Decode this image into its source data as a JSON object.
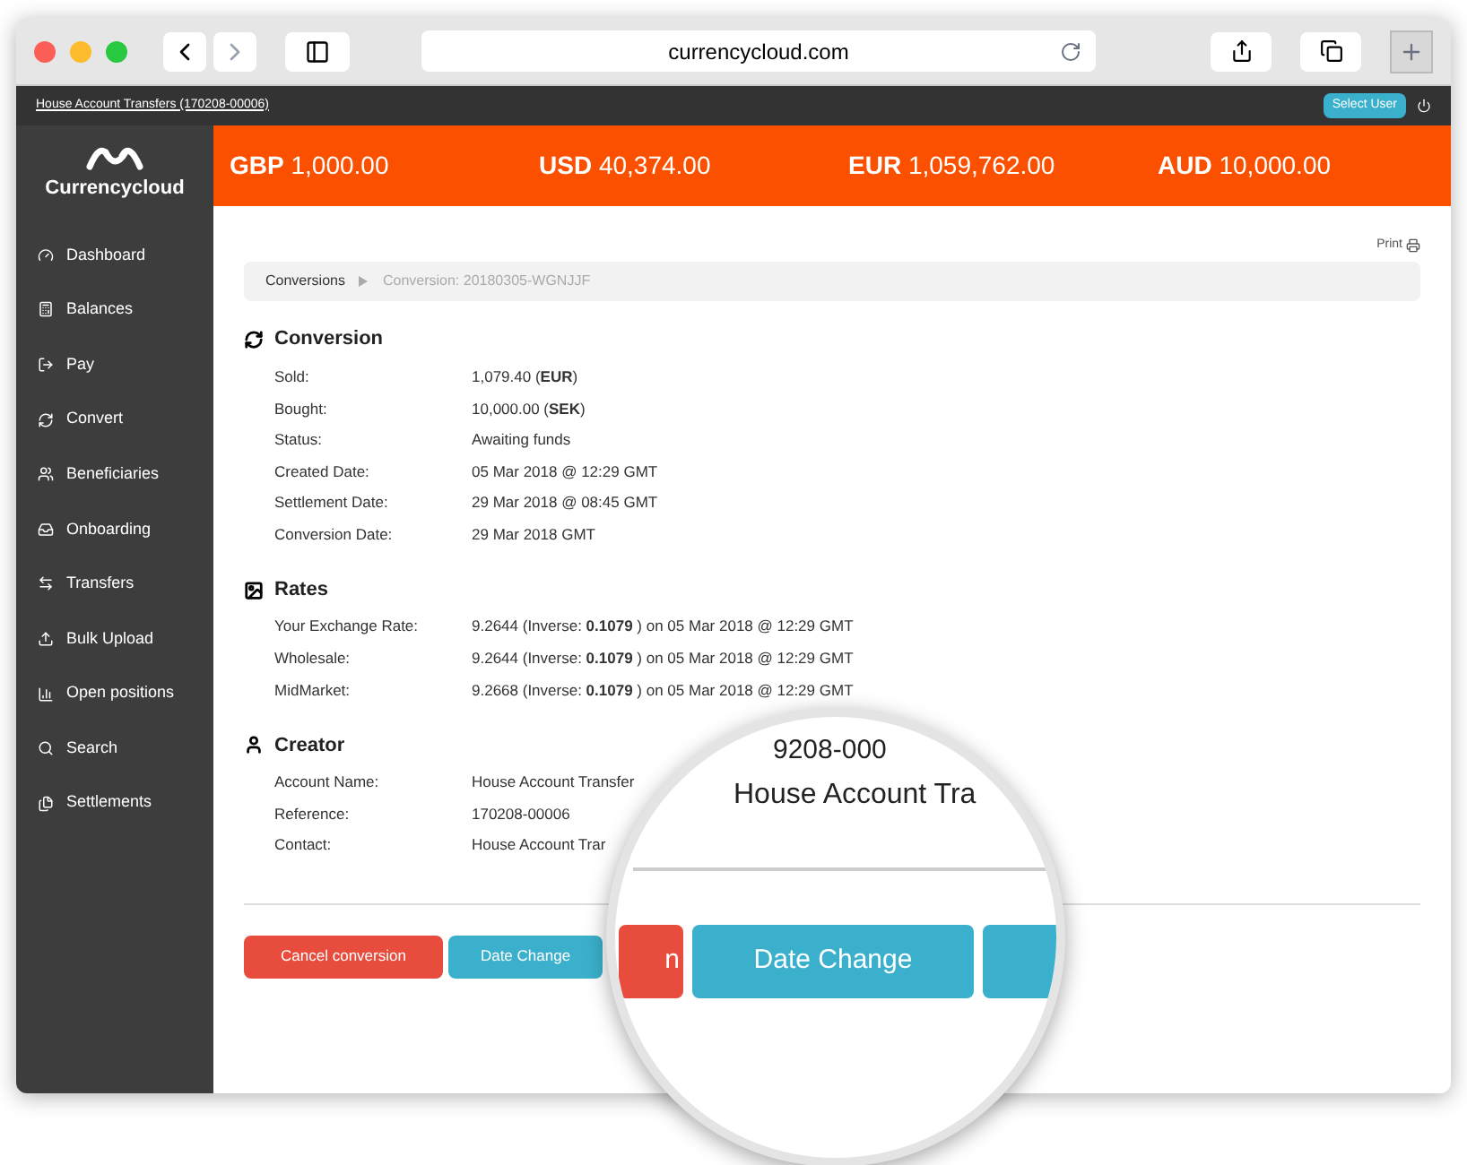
{
  "browser": {
    "url": "currencycloud.com"
  },
  "top_bar": {
    "account_link": "House Account Transfers (170208-00006)",
    "select_user_button": "Select User"
  },
  "logo": {
    "name": "Currencycloud"
  },
  "balances": [
    {
      "currency": "GBP",
      "amount": "1,000.00"
    },
    {
      "currency": "USD",
      "amount": "40,374.00"
    },
    {
      "currency": "EUR",
      "amount": "1,059,762.00"
    },
    {
      "currency": "AUD",
      "amount": "10,000.00"
    }
  ],
  "sidebar": {
    "items": [
      {
        "label": "Dashboard"
      },
      {
        "label": "Balances"
      },
      {
        "label": "Pay"
      },
      {
        "label": "Convert"
      },
      {
        "label": "Beneficiaries"
      },
      {
        "label": "Onboarding"
      },
      {
        "label": "Transfers"
      },
      {
        "label": "Bulk Upload"
      },
      {
        "label": "Open positions"
      },
      {
        "label": "Search"
      },
      {
        "label": "Settlements"
      }
    ]
  },
  "print_link": "Print",
  "breadcrumb": [
    {
      "label": "Conversions",
      "current": false
    },
    {
      "label": "Conversion: 20180305-WGNJJF",
      "current": true
    }
  ],
  "sections": [
    {
      "title": "Conversion",
      "rows": [
        {
          "label": "Sold:",
          "value": "1,079.40 (**EUR**)"
        },
        {
          "label": "Bought:",
          "value": "10,000.00 (**SEK**)"
        },
        {
          "label": "Status:",
          "value": "Awaiting funds"
        },
        {
          "label": "Created Date:",
          "value": "05 Mar 2018 @ 12:29 GMT"
        },
        {
          "label": "Settlement Date:",
          "value": "29 Mar 2018 @ 08:45 GMT"
        },
        {
          "label": "Conversion Date:",
          "value": "29 Mar 2018 GMT"
        }
      ]
    },
    {
      "title": "Rates",
      "rows": [
        {
          "label": "Your Exchange Rate:",
          "value": "9.2644 (Inverse: **0.1079** ) on 05 Mar 2018 @ 12:29 GMT"
        },
        {
          "label": "Wholesale:",
          "value": "9.2644 (Inverse: **0.1079** ) on 05 Mar 2018 @ 12:29 GMT"
        },
        {
          "label": "MidMarket:",
          "value": "9.2668 (Inverse: **0.1079** ) on 05 Mar 2018 @ 12:29 GMT"
        }
      ]
    },
    {
      "title": "Creator",
      "rows": [
        {
          "label": "Account Name:",
          "value": "House Account Transfer"
        },
        {
          "label": "Reference:",
          "value": "170208-00006"
        },
        {
          "label": "Contact:",
          "value": "House Account Trar"
        }
      ]
    }
  ],
  "actions": [
    {
      "label": "Cancel conversion",
      "kind": "danger"
    },
    {
      "label": "Date Change",
      "kind": "info"
    }
  ],
  "magnifier": {
    "lines": [
      "9208-000",
      "House Account Tra"
    ],
    "buttons": [
      {
        "label": "n",
        "kind": "danger"
      },
      {
        "label": "Date Change",
        "kind": "info"
      },
      {
        "kind": "info"
      }
    ]
  }
}
